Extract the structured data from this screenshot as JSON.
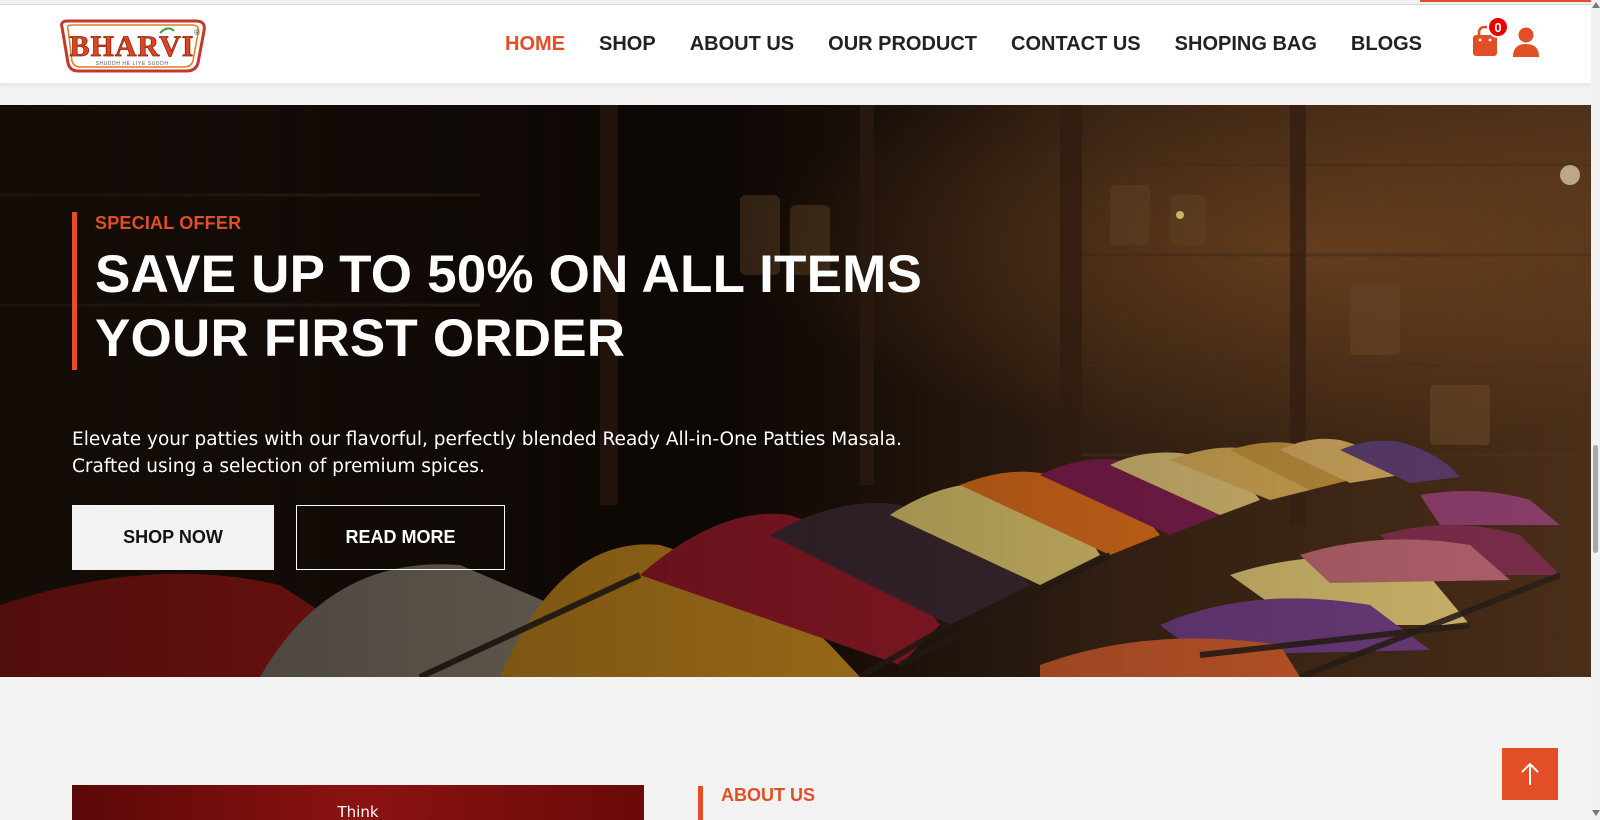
{
  "brand": {
    "logo_text": "BHARVI",
    "logo_tagline": "SHUDDH HE LIYE SUDDH",
    "logo_mark": "®",
    "accent_color": "#e24e25"
  },
  "nav": {
    "items": [
      {
        "label": "HOME",
        "active": true
      },
      {
        "label": "SHOP",
        "active": false
      },
      {
        "label": "ABOUT US",
        "active": false
      },
      {
        "label": "OUR PRODUCT",
        "active": false
      },
      {
        "label": "CONTACT US",
        "active": false
      },
      {
        "label": "SHOPING BAG",
        "active": false
      },
      {
        "label": "BLOGS",
        "active": false
      }
    ]
  },
  "cart": {
    "count": "0",
    "icon": "shopping-bag-icon"
  },
  "account": {
    "icon": "user-icon"
  },
  "hero": {
    "tag": "SPECIAL OFFER",
    "headline_line1": "SAVE UP TO 50% ON ALL ITEMS",
    "headline_line2": "YOUR FIRST ORDER",
    "description_line1": "Elevate your patties with our flavorful, perfectly blended Ready All-in-One Patties Masala.",
    "description_line2": "Crafted using a selection of premium spices.",
    "primary_button": "SHOP NOW",
    "secondary_button": "READ MORE"
  },
  "about": {
    "label": "ABOUT US",
    "image_text": "Think"
  },
  "scroll_top": {
    "icon": "arrow-up-icon"
  }
}
